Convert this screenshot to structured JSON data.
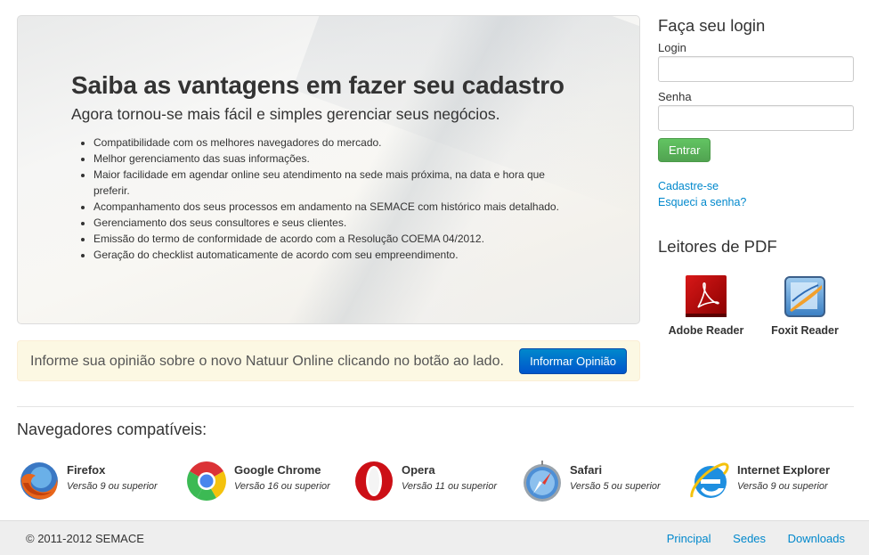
{
  "hero": {
    "title": "Saiba as vantagens em fazer seu cadastro",
    "subtitle": "Agora tornou-se mais fácil e simples gerenciar seus negócios.",
    "benefits": [
      "Compatibilidade com os melhores navegadores do mercado.",
      "Melhor gerenciamento das suas informações.",
      "Maior facilidade em agendar online seu atendimento na sede mais próxima, na data e hora que preferir.",
      "Acompanhamento dos seus processos em andamento na SEMACE com histórico mais detalhado.",
      "Gerenciamento dos seus consultores e seus clientes.",
      "Emissão do termo de conformidade de acordo com a Resolução COEMA 04/2012.",
      "Geração do checklist automaticamente de acordo com seu empreendimento."
    ]
  },
  "opinion": {
    "text": "Informe sua opinião sobre o novo Natuur Online clicando no botão ao lado.",
    "button_label": "Informar Opinião"
  },
  "login": {
    "title": "Faça seu login",
    "login_label": "Login",
    "login_value": "",
    "password_label": "Senha",
    "password_value": "",
    "submit_label": "Entrar",
    "register_link": "Cadastre-se",
    "forgot_link": "Esqueci a senha?"
  },
  "pdf_readers": {
    "title": "Leitores de PDF",
    "items": [
      {
        "name": "Adobe Reader",
        "icon": "adobe-reader-icon"
      },
      {
        "name": "Foxit Reader",
        "icon": "foxit-reader-icon"
      }
    ]
  },
  "browsers": {
    "title": "Navegadores compatíveis:",
    "items": [
      {
        "name": "Firefox",
        "version": "Versão 9 ou superior",
        "icon": "firefox-icon"
      },
      {
        "name": "Google Chrome",
        "version": "Versão 16 ou superior",
        "icon": "chrome-icon"
      },
      {
        "name": "Opera",
        "version": "Versão 11 ou superior",
        "icon": "opera-icon"
      },
      {
        "name": "Safari",
        "version": "Versão 5 ou superior",
        "icon": "safari-icon"
      },
      {
        "name": "Internet Explorer",
        "version": "Versão 9 ou superior",
        "icon": "internet-explorer-icon"
      }
    ]
  },
  "footer": {
    "copyright": "© 2011-2012 SEMACE",
    "links": [
      "Principal",
      "Sedes",
      "Downloads"
    ]
  },
  "colors": {
    "link": "#0088cc",
    "primary_button": "#0070cc",
    "success_button": "#5bb75b",
    "alert_background": "#fcf8e3"
  }
}
